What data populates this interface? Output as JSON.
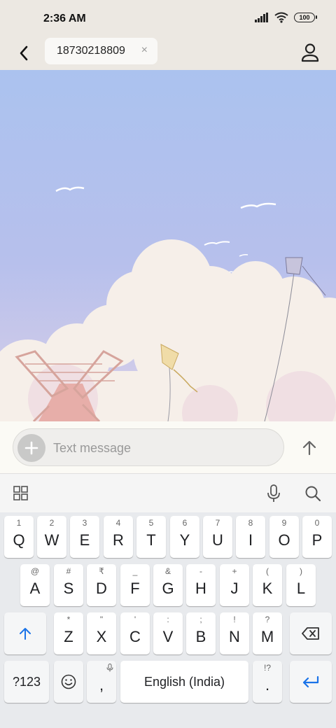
{
  "status_bar": {
    "time": "2:36 AM",
    "battery": "100"
  },
  "header": {
    "recipient": "18730218809",
    "chip_close": "×"
  },
  "compose": {
    "placeholder": "Text message"
  },
  "keyboard": {
    "row1": [
      {
        "hint": "1",
        "label": "Q"
      },
      {
        "hint": "2",
        "label": "W"
      },
      {
        "hint": "3",
        "label": "E"
      },
      {
        "hint": "4",
        "label": "R"
      },
      {
        "hint": "5",
        "label": "T"
      },
      {
        "hint": "6",
        "label": "Y"
      },
      {
        "hint": "7",
        "label": "U"
      },
      {
        "hint": "8",
        "label": "I"
      },
      {
        "hint": "9",
        "label": "O"
      },
      {
        "hint": "0",
        "label": "P"
      }
    ],
    "row2": [
      {
        "hint": "@",
        "label": "A"
      },
      {
        "hint": "#",
        "label": "S"
      },
      {
        "hint": "₹",
        "label": "D"
      },
      {
        "hint": "_",
        "label": "F"
      },
      {
        "hint": "&",
        "label": "G"
      },
      {
        "hint": "-",
        "label": "H"
      },
      {
        "hint": "+",
        "label": "J"
      },
      {
        "hint": "(",
        "label": "K"
      },
      {
        "hint": ")",
        "label": "L"
      }
    ],
    "row3": [
      {
        "hint": "*",
        "label": "Z"
      },
      {
        "hint": "\"",
        "label": "X"
      },
      {
        "hint": "'",
        "label": "C"
      },
      {
        "hint": ":",
        "label": "V"
      },
      {
        "hint": ";",
        "label": "B"
      },
      {
        "hint": "!",
        "label": "N"
      },
      {
        "hint": "?",
        "label": "M"
      }
    ],
    "symbols_label": "?123",
    "comma": ",",
    "space_label": "English (India)",
    "period": ".",
    "period_hint": "!?",
    "accent_color": "#1a73e8"
  }
}
